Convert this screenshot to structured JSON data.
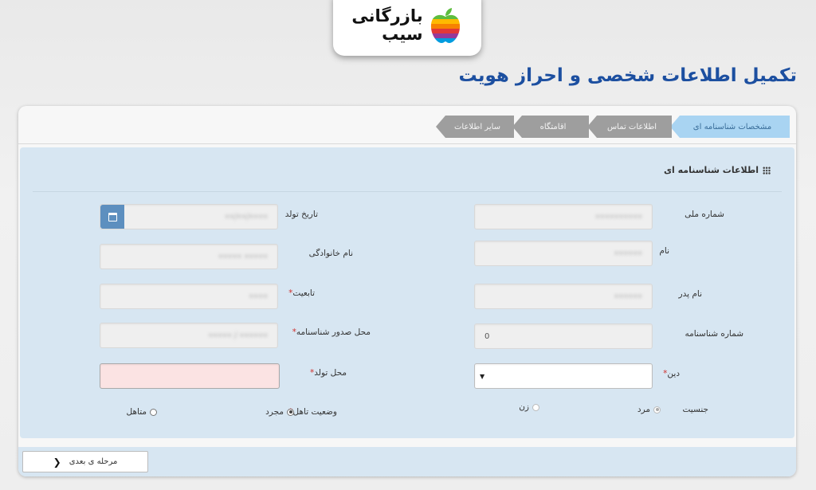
{
  "brand": {
    "line1": "بازرگانی",
    "line2": "سیب",
    "logo_icon": "rainbow-apple-icon"
  },
  "page_title": "تکمیل اطلاعات شخصی و  احراز هویت",
  "tabs": [
    {
      "label": "مشخصات شناسنامه ای",
      "state": "active"
    },
    {
      "label": "اطلاعات تماس",
      "state": "inactive"
    },
    {
      "label": "اقامتگاه",
      "state": "inactive"
    },
    {
      "label": "سایر اطلاعات",
      "state": "inactive"
    }
  ],
  "section": {
    "title": "اطلاعات شناسنامه ای",
    "icon": "grid-icon"
  },
  "fields": {
    "national_id": {
      "label": "شماره ملی",
      "value": "••••••••••"
    },
    "birth_date": {
      "label": "تاریخ تولد",
      "value": "••••/••/••"
    },
    "first_name": {
      "label": "نام",
      "value": "••••••"
    },
    "last_name": {
      "label": "نام خانوادگی",
      "value": "••••• •••••"
    },
    "father_name": {
      "label": "نام پدر",
      "value": "••••••"
    },
    "nationality": {
      "label": "تابعیت",
      "value": "••••"
    },
    "id_number": {
      "label": "شماره شناسنامه",
      "value": "0"
    },
    "issue_place": {
      "label": "محل صدور شناسنامه",
      "value": "•••••• / •••••"
    },
    "religion": {
      "label": "دین",
      "value": ""
    },
    "birth_place": {
      "label": "محل تولد",
      "value": ""
    }
  },
  "gender": {
    "label": "جنسیت",
    "options": [
      "مرد",
      "زن"
    ],
    "selected": "مرد"
  },
  "marital": {
    "label": "وضعیت تاهل",
    "options": [
      "مجرد",
      "متاهل"
    ],
    "selected": "مجرد"
  },
  "colors": {
    "title_blue": "#1c4fa0",
    "active_tab": "#a9d4f2",
    "inactive_tab": "#9e9e9e",
    "form_bg": "#d7e6f2",
    "required": "#d0312d",
    "error_field": "#fbe3e3"
  },
  "footer": {
    "next_label": "مرحله ی بعدی",
    "next_icon": "chevron-left-icon"
  }
}
